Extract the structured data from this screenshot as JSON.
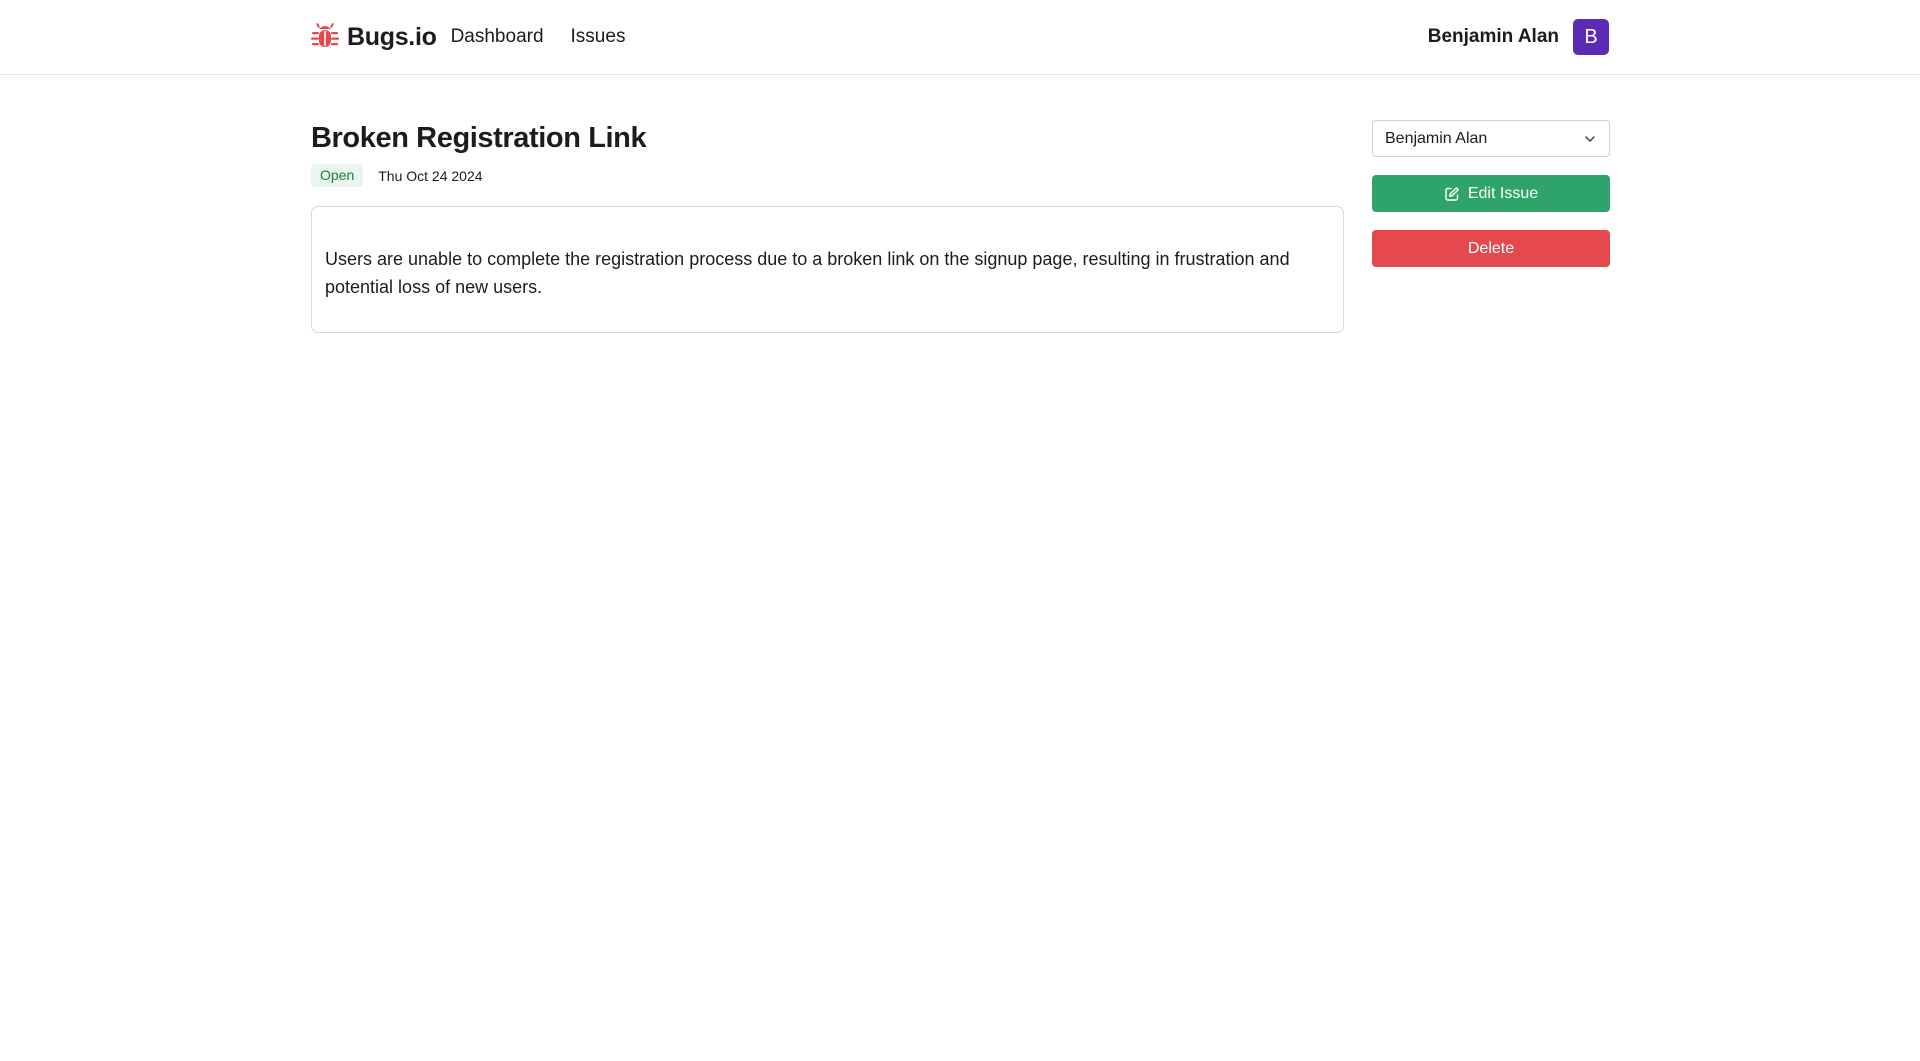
{
  "brand": {
    "name": "Bugs.io",
    "logo_icon": "bug-icon",
    "logo_color": "#e5484d"
  },
  "nav": {
    "items": [
      {
        "label": "Dashboard"
      },
      {
        "label": "Issues"
      }
    ]
  },
  "user": {
    "name": "Benjamin Alan",
    "avatar_initial": "B",
    "avatar_color": "#5b2bb5"
  },
  "issue": {
    "title": "Broken Registration Link",
    "status": "Open",
    "date": "Thu Oct 24 2024",
    "description": "Users are unable to complete the registration process due to a broken link on the signup page, resulting in frustration and potential loss of new users."
  },
  "sidebar": {
    "assignee": {
      "selected": "Benjamin Alan"
    },
    "edit_label": "Edit Issue",
    "delete_label": "Delete",
    "edit_color": "#2fa46a",
    "delete_color": "#e5484d"
  }
}
